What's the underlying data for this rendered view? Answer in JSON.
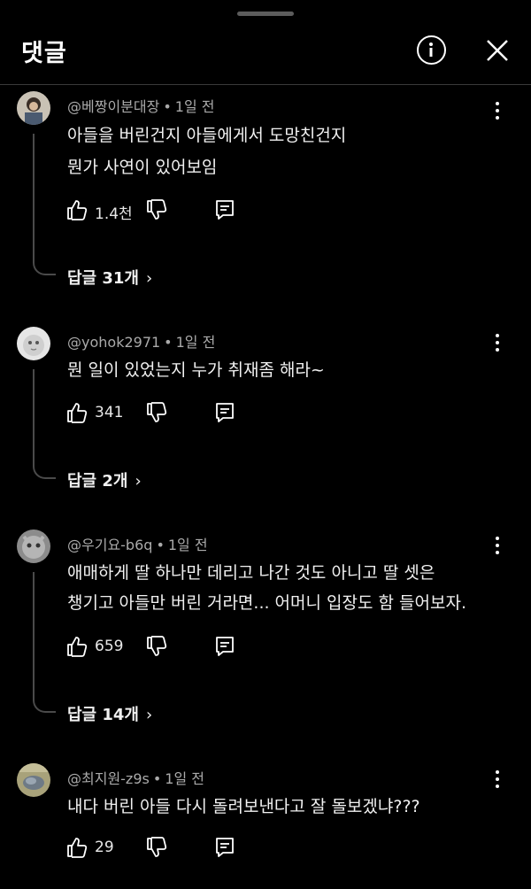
{
  "header": {
    "title": "댓글"
  },
  "comments": [
    {
      "author": "@베짱이분대장",
      "time": "1일 전",
      "lines": [
        "아들을 버린건지 아들에게서 도망친건지",
        "뭔가 사연이 있어보임"
      ],
      "likes": "1.4천",
      "replies": "답글 31개",
      "avatar_color": "#6b5a4a"
    },
    {
      "author": "@yohok2971",
      "time": "1일 전",
      "lines": [
        "뭔 일이 있었는지 누가 취재좀 해라~"
      ],
      "likes": "341",
      "replies": "답글 2개",
      "avatar_color": "#d8d8d8"
    },
    {
      "author": "@우기요-b6q",
      "time": "1일 전",
      "lines": [
        "애매하게 딸 하나만 데리고 나간 것도 아니고 딸 셋은",
        "챙기고 아들만 버린 거라면... 어머니 입장도 함 들어보자."
      ],
      "likes": "659",
      "replies": "답글 14개",
      "avatar_color": "#9a9a9a"
    },
    {
      "author": "@최지원-z9s",
      "time": "1일 전",
      "lines": [
        "내다 버린 아들 다시 돌려보낸다고 잘 돌보겠냐???"
      ],
      "likes": "29",
      "avatar_color": "#8a8468"
    }
  ]
}
